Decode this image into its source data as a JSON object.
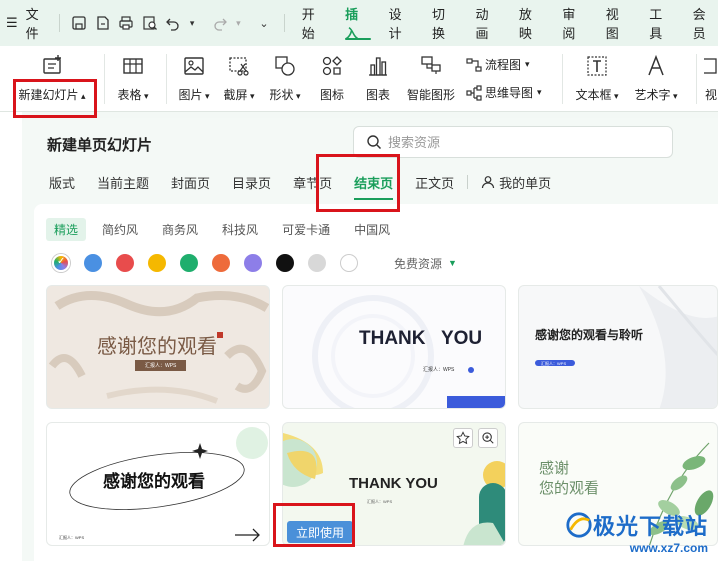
{
  "menubar": {
    "file_label": "文件",
    "tabs": [
      "开始",
      "插入",
      "设计",
      "切换",
      "动画",
      "放映",
      "审阅",
      "视图",
      "工具",
      "会员"
    ],
    "active_tab": "插入"
  },
  "ribbon": {
    "new_slide": "新建幻灯片",
    "table": "表格",
    "picture": "图片",
    "screenshot": "截屏",
    "shape": "形状",
    "icon": "图标",
    "chart": "图表",
    "smart_art": "智能图形",
    "flowchart": "流程图",
    "mindmap": "思维导图",
    "textbox": "文本框",
    "wordart": "艺术字",
    "video": "视"
  },
  "panel": {
    "title": "新建单页幻灯片",
    "search_placeholder": "搜索资源",
    "categories": [
      "版式",
      "当前主题",
      "封面页",
      "目录页",
      "章节页",
      "结束页",
      "正文页"
    ],
    "my_pages": "我的单页",
    "active_category": "结束页",
    "styles": [
      "精选",
      "简约风",
      "商务风",
      "科技风",
      "可爱卡通",
      "中国风"
    ],
    "active_style": "精选",
    "colors": [
      "#4a90e2",
      "#e84c4c",
      "#f5b800",
      "#1fae6d",
      "#ee6b3b",
      "#8d7ee8",
      "#111111",
      "#d8d8d8",
      "#ffffff"
    ],
    "free_resources": "免费资源"
  },
  "cards": {
    "c1_title": "感谢您的观看",
    "c1_sub": "汇报人：WPS",
    "c2_title": "THANK   YOU",
    "c2_sub": "汇报人：WPS",
    "c3_title": "感谢您的观看与聆听",
    "c3_sub": "汇报人：WPS",
    "c4_title": "感谢您的观看",
    "c4_sub": "汇报人：WPS",
    "c5_title": "THANK YOU",
    "c5_sub": "汇报人：WPS",
    "c5_use": "立即使用",
    "c6_title1": "感谢",
    "c6_title2": "您的观看"
  },
  "watermark": {
    "brand": "极光下载站",
    "url": "www.xz7.com"
  }
}
